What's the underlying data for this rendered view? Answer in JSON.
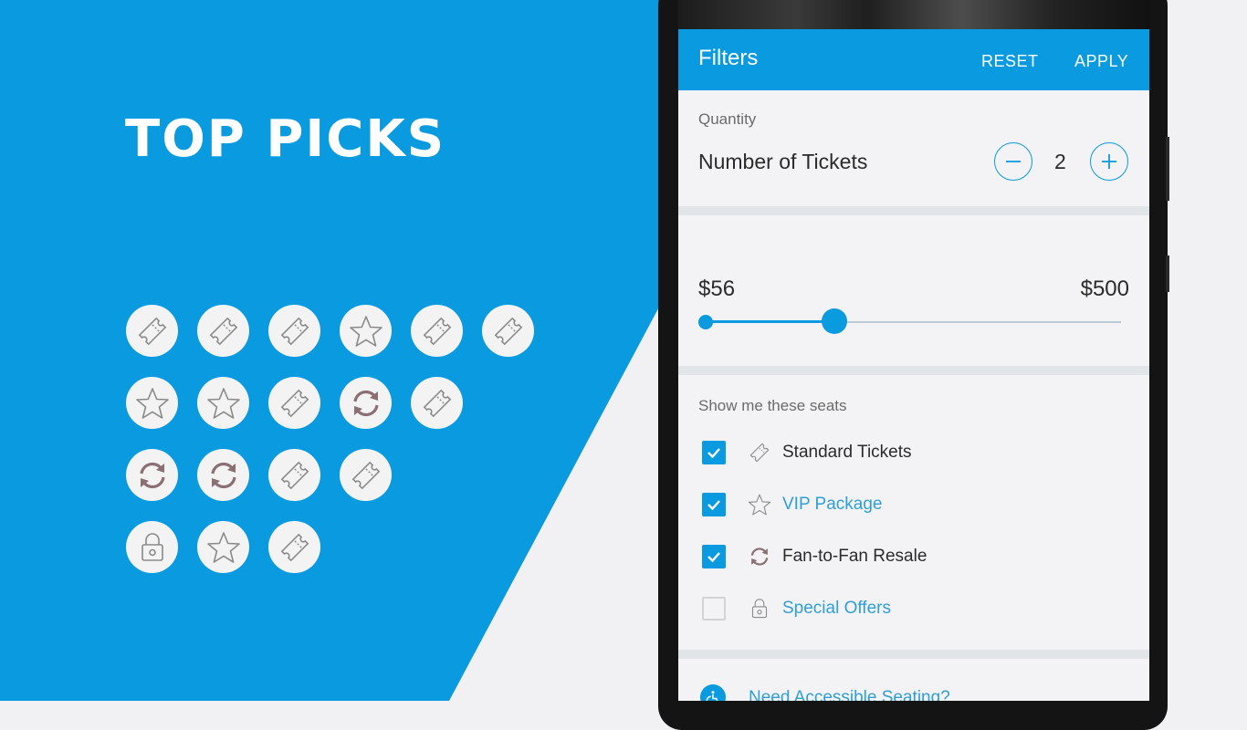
{
  "promo": {
    "headline": "TOP PICKS",
    "icon_grid": [
      [
        "ticket-icon",
        "ticket-icon",
        "ticket-icon",
        "star-icon",
        "ticket-icon",
        "ticket-icon"
      ],
      [
        "star-icon",
        "star-icon",
        "ticket-icon",
        "resale-icon",
        "ticket-icon"
      ],
      [
        "resale-icon",
        "resale-icon",
        "ticket-icon",
        "ticket-icon"
      ],
      [
        "lock-icon",
        "star-icon",
        "ticket-icon"
      ]
    ]
  },
  "app": {
    "appbar": {
      "title": "Filters",
      "reset_label": "RESET",
      "apply_label": "APPLY"
    },
    "quantity": {
      "section_label": "Quantity",
      "row_label": "Number of Tickets",
      "value": "2"
    },
    "price": {
      "min_label": "$56",
      "max_label": "$500",
      "selected_fraction": 0.31
    },
    "seats": {
      "section_label": "Show me these seats",
      "items": [
        {
          "label": "Standard Tickets",
          "icon": "ticket-icon",
          "checked": true,
          "color": "#2b2b2b"
        },
        {
          "label": "VIP Package",
          "icon": "star-icon",
          "checked": true,
          "color": "#2f9fd6"
        },
        {
          "label": "Fan-to-Fan Resale",
          "icon": "resale-icon",
          "checked": true,
          "color": "#2b2b2b"
        },
        {
          "label": "Special Offers",
          "icon": "lock-icon",
          "checked": false,
          "color": "#2f9fd6"
        }
      ]
    },
    "accessible_link": "Need Accessible Seating?"
  },
  "colors": {
    "brand_blue": "#0a9ae0",
    "link_blue": "#2f9fd6",
    "icon_gray": "#8a8a8a",
    "resale_mauve": "#8a6f74"
  }
}
